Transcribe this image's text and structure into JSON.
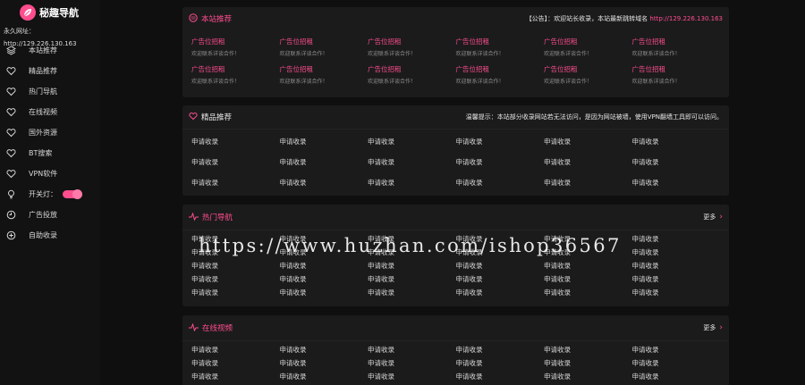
{
  "brand": {
    "name": "秘趣导航",
    "color": "#ff4d8d"
  },
  "sidebar": {
    "permanent_url": "永久网址：http://129.226.130.163",
    "items": [
      {
        "label": "本站推荐",
        "icon": "cubes-icon"
      },
      {
        "label": "精品推荐",
        "icon": "heart-icon"
      },
      {
        "label": "热门导航",
        "icon": "heart-icon"
      },
      {
        "label": "在线视频",
        "icon": "heart-icon"
      },
      {
        "label": "国外资源",
        "icon": "heart-icon"
      },
      {
        "label": "BT搜索",
        "icon": "heart-icon"
      },
      {
        "label": "VPN软件",
        "icon": "heart-icon"
      },
      {
        "label": "开关灯：",
        "icon": "bulb-icon"
      },
      {
        "label": "广告投放",
        "icon": "clock-icon"
      },
      {
        "label": "自助收录",
        "icon": "plus-circle-icon"
      }
    ]
  },
  "recommend": {
    "title": "本站推荐",
    "notice_prefix": "【公告】：欢迎站长收录，本站最新跳转域名",
    "notice_link": "http://129.226.130.163",
    "ad_title": "广告位招租",
    "ad_sub": "欢迎联系详谈合作！"
  },
  "premium": {
    "title": "精品推荐",
    "notice": "温馨提示：本站部分收录网站若无法访问，是因为网站被墙，使用VPN翻墙工具即可以访问。",
    "cell": "申请收录"
  },
  "hot": {
    "title": "热门导航",
    "more": "更多",
    "cell": "申请收录"
  },
  "video": {
    "title": "在线视频",
    "more": "更多",
    "cell": "申请收录"
  },
  "watermark": "https://www.huzhan.com/ishop36567"
}
